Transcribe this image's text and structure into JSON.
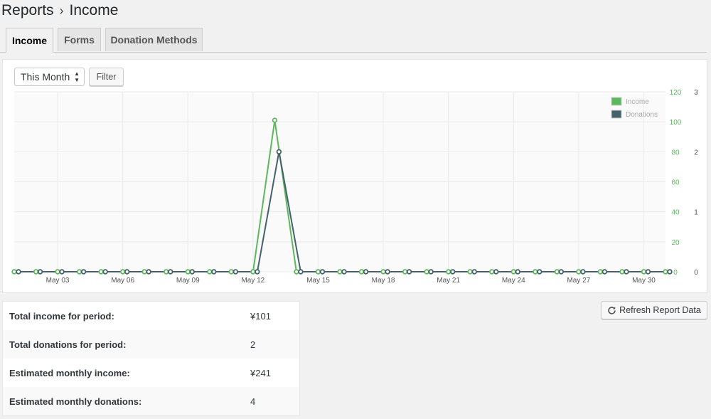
{
  "breadcrumb": {
    "parent": "Reports",
    "separator": "›",
    "current": "Income"
  },
  "tabs": [
    {
      "label": "Income",
      "active": true
    },
    {
      "label": "Forms",
      "active": false
    },
    {
      "label": "Donation Methods",
      "active": false
    }
  ],
  "filter": {
    "range_value": "This Month",
    "button_label": "Filter"
  },
  "colors": {
    "income": "#5cb85c",
    "donations": "#46606d",
    "grid": "#ebebeb"
  },
  "chart_data": {
    "type": "line",
    "x_ticks": [
      "May 03",
      "May 06",
      "May 09",
      "May 12",
      "May 15",
      "May 18",
      "May 21",
      "May 24",
      "May 27",
      "May 30"
    ],
    "x": [
      1,
      2,
      3,
      4,
      5,
      6,
      7,
      8,
      9,
      10,
      11,
      12,
      13,
      14,
      15,
      16,
      17,
      18,
      19,
      20,
      21,
      22,
      23,
      24,
      25,
      26,
      27,
      28,
      29,
      30,
      31
    ],
    "series": [
      {
        "name": "Income",
        "axis": "left",
        "values": [
          0,
          0,
          0,
          0,
          0,
          0,
          0,
          0,
          0,
          0,
          0,
          0,
          101,
          0,
          0,
          0,
          0,
          0,
          0,
          0,
          0,
          0,
          0,
          0,
          0,
          0,
          0,
          0,
          0,
          0,
          0
        ]
      },
      {
        "name": "Donations",
        "axis": "right",
        "values": [
          0,
          0,
          0,
          0,
          0,
          0,
          0,
          0,
          0,
          0,
          0,
          0,
          2,
          0,
          0,
          0,
          0,
          0,
          0,
          0,
          0,
          0,
          0,
          0,
          0,
          0,
          0,
          0,
          0,
          0,
          0
        ]
      }
    ],
    "y_left_ticks": [
      "120",
      "100",
      "80",
      "60",
      "40",
      "20",
      "0"
    ],
    "y_left_range": [
      0,
      120
    ],
    "y_right_ticks": [
      "3",
      "2",
      "1",
      "0"
    ],
    "y_right_range": [
      0,
      3
    ],
    "legend": [
      "Income",
      "Donations"
    ],
    "legend_position": "top-right",
    "grid": true
  },
  "stats": [
    {
      "label": "Total income for period:",
      "value": "¥101"
    },
    {
      "label": "Total donations for period:",
      "value": "2"
    },
    {
      "label": "Estimated monthly income:",
      "value": "¥241"
    },
    {
      "label": "Estimated monthly donations:",
      "value": "4"
    }
  ],
  "refresh": {
    "label": "Refresh Report Data",
    "icon": "refresh-icon"
  }
}
